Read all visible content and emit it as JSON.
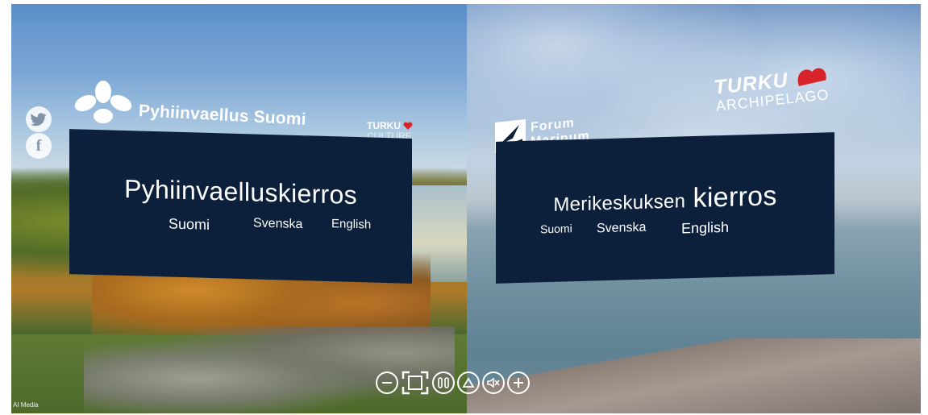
{
  "left_tour": {
    "title": "Pyhiinvaelluskierros",
    "languages": [
      "Suomi",
      "Svenska",
      "English"
    ],
    "brand": "Pyhiinvaellus Suomi",
    "partner_line1": "TURKU",
    "partner_line2": "CULTURE"
  },
  "right_tour": {
    "title_part1": "Merikeskuksen",
    "title_part2": "kierros",
    "languages": [
      "Suomi",
      "Svenska",
      "English"
    ],
    "forum_line1": "Forum",
    "forum_line2": "Marinum",
    "turku_line1": "TURKU",
    "turku_line2": "ARCHIPELAGO"
  },
  "social": {
    "twitter_glyph": "🐦",
    "facebook_glyph": "f"
  },
  "controls": [
    "zoom-out-icon",
    "fullscreen-icon",
    "pause-icon",
    "up-icon",
    "mute-icon",
    "zoom-in-icon"
  ],
  "colors": {
    "panel": "#0c1f3b",
    "accent_red": "#d8232a"
  },
  "watermark": "AI Media"
}
